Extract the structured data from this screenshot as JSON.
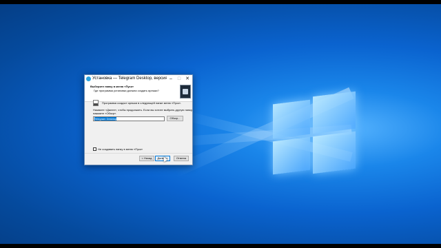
{
  "window": {
    "title": "Установка — Telegram Desktop, версия...",
    "minimize": "–",
    "maximize": "□",
    "close": "✕"
  },
  "header": {
    "title": "Выберите папку в меню «Пуск»",
    "subtitle": "Где программа установки должна создать ярлыки?"
  },
  "body": {
    "info_line": "Программа создаст ярлыки в следующей папке меню «Пуск».",
    "instruction_line1": "Нажмите «Далее», чтобы продолжить. Если вы хотите выбрать другую папку,",
    "instruction_line2": "нажмите «Обзор».",
    "folder_value": "Telegram Desktop",
    "browse_label": "Обзор...",
    "no_folder_label": "Не создавать папку в меню «Пуск»",
    "no_folder_checked": false
  },
  "buttons": {
    "back": "< Назад",
    "next": "Далее >",
    "cancel": "Отмена"
  },
  "colors": {
    "selection": "#0078d7",
    "desktop_blue": "#0a63cf"
  },
  "icons": {
    "app": "telegram-icon",
    "header": "installer-icon",
    "folder": "folder-icon"
  }
}
